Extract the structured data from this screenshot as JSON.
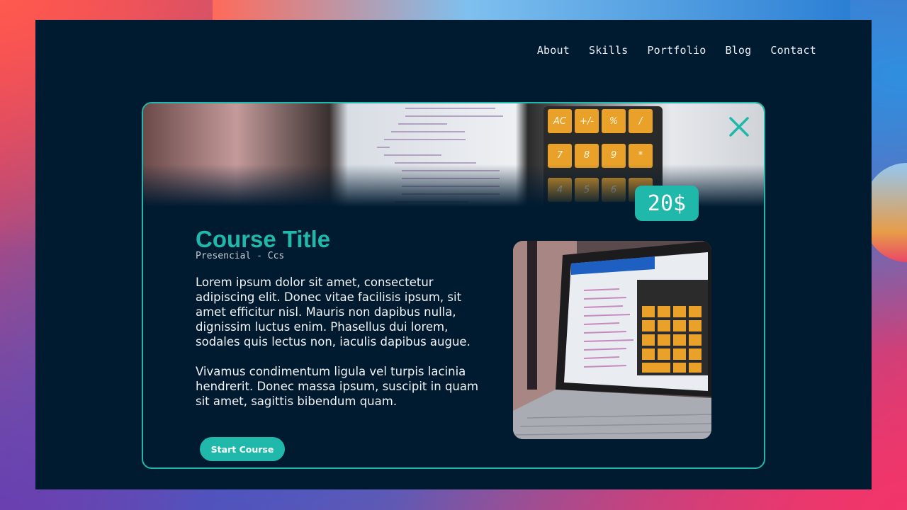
{
  "nav": {
    "items": [
      {
        "label": "About"
      },
      {
        "label": "Skills"
      },
      {
        "label": "Portfolio"
      },
      {
        "label": "Blog"
      },
      {
        "label": "Contact"
      }
    ]
  },
  "course": {
    "price": "20$",
    "title": "Course Title",
    "subtitle": "Presencial - Ccs",
    "paragraphs": [
      "Lorem ipsum dolor sit amet, consectetur adipiscing elit. Donec vitae facilisis ipsum, sit amet efficitur nisl. Mauris non dapibus nulla, dignissim luctus enim. Phasellus dui lorem, sodales quis lectus non, iaculis dapibus augue.",
      "Vivamus condimentum ligula vel turpis lacinia hendrerit. Donec massa ipsum, suscipit in quam sit amet, sagittis bibendum quam."
    ],
    "start_label": "Start Course",
    "close_icon": "close-icon"
  },
  "banner_calc_keys": [
    "AC",
    "+/-",
    "%",
    "/",
    "7",
    "8",
    "9",
    "*",
    "4",
    "5",
    "6",
    "-"
  ],
  "colors": {
    "accent": "#1fb8aa",
    "background": "#001a30"
  }
}
